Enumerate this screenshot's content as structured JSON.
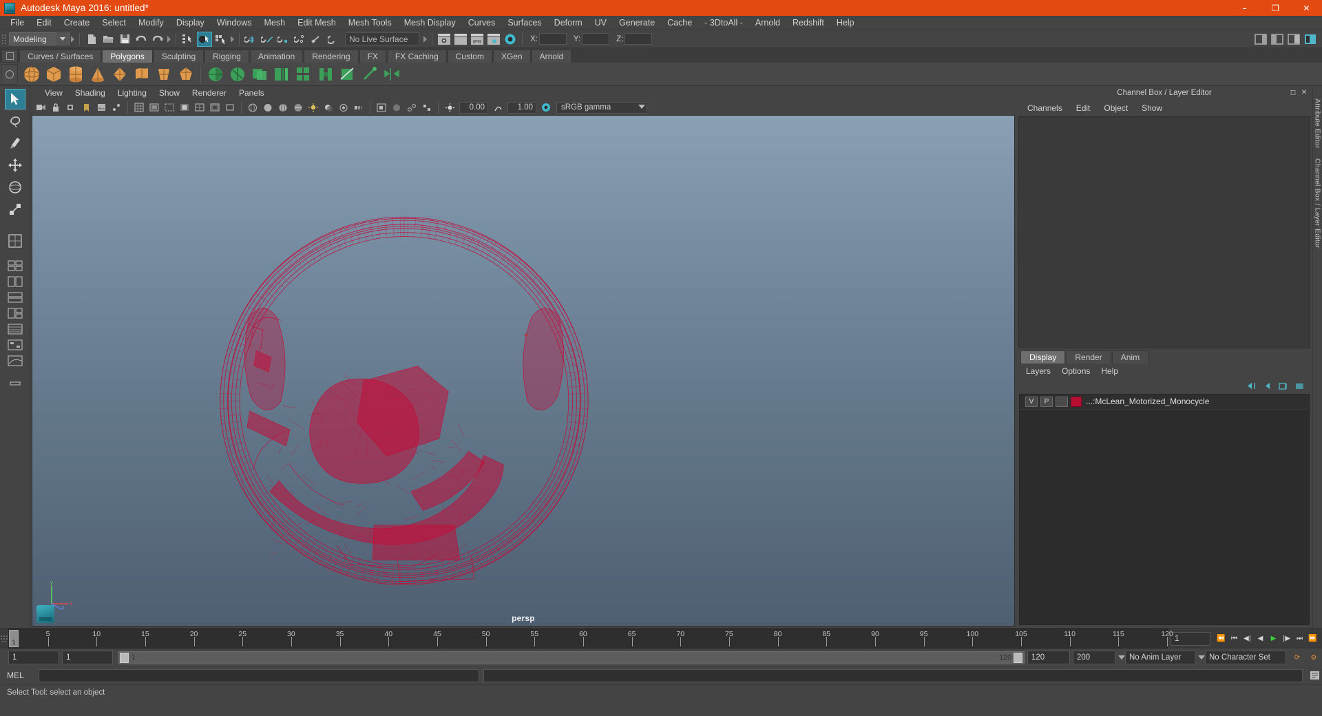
{
  "window": {
    "title": "Autodesk Maya 2016: untitled*",
    "app_icon": "maya-logo-icon",
    "minimize": "–",
    "maximize": "❐",
    "close": "✕",
    "accent_color": "#e34a12"
  },
  "menubar": {
    "items": [
      "File",
      "Edit",
      "Create",
      "Select",
      "Modify",
      "Display",
      "Windows",
      "Mesh",
      "Edit Mesh",
      "Mesh Tools",
      "Mesh Display",
      "Curves",
      "Surfaces",
      "Deform",
      "UV",
      "Generate",
      "Cache",
      "- 3DtoAll -",
      "Arnold",
      "Redshift",
      "Help"
    ]
  },
  "toolbar": {
    "mode": "Modeling",
    "live_surface": "No Live Surface",
    "coord_x_label": "X:",
    "coord_y_label": "Y:",
    "coord_z_label": "Z:",
    "coord_x_value": "",
    "coord_y_value": "",
    "coord_z_value": "",
    "icons": [
      "new-scene-icon",
      "open-scene-icon",
      "save-scene-icon",
      "undo-icon",
      "redo-icon",
      "select-by-hierarchy-icon",
      "select-by-object-icon",
      "select-by-component-icon",
      "snap-to-grid-icon",
      "snap-to-curve-icon",
      "snap-to-point-icon",
      "snap-to-projected-center-icon",
      "snap-to-view-plane-icon",
      "make-live-icon",
      "render-current-frame-icon",
      "render-sequence-icon",
      "ipr-render-icon",
      "render-settings-icon",
      "hypershade-icon",
      "editor-layout-icon"
    ]
  },
  "shelf": {
    "tabs": [
      "Curves / Surfaces",
      "Polygons",
      "Sculpting",
      "Rigging",
      "Animation",
      "Rendering",
      "FX",
      "FX Caching",
      "Custom",
      "XGen",
      "Arnold"
    ],
    "active_tab": "Polygons",
    "icons": [
      "poly-sphere-icon",
      "poly-cube-icon",
      "poly-cylinder-icon",
      "poly-cone-icon",
      "poly-torus-icon",
      "poly-plane-icon",
      "poly-disc-icon",
      "poly-platonic-icon",
      "poly-pyramid-icon",
      "poly-prism-icon",
      "poly-pipe-icon",
      "poly-helix-icon",
      "poly-gear-icon",
      "poly-soccer-ball-icon",
      "poly-super-ellipse-icon",
      "combine-icon",
      "separate-icon",
      "boolean-union-icon",
      "boolean-difference-icon",
      "boolean-intersection-icon",
      "smooth-icon",
      "extrude-icon",
      "bevel-icon",
      "bridge-icon",
      "append-polygon-icon",
      "multi-cut-icon",
      "target-weld-icon",
      "quad-draw-icon",
      "mirror-icon",
      "reduce-icon",
      "triangulate-icon",
      "quadrangulate-icon",
      "crease-icon"
    ]
  },
  "toolbox": {
    "tools": [
      {
        "name": "select-tool",
        "icon": "arrow-cursor-icon",
        "selected": true
      },
      {
        "name": "lasso-select-tool",
        "icon": "lasso-icon",
        "selected": false
      },
      {
        "name": "paint-select-tool",
        "icon": "paint-brush-icon",
        "selected": false
      },
      {
        "name": "move-tool",
        "icon": "move-arrows-icon",
        "selected": false
      },
      {
        "name": "rotate-tool",
        "icon": "rotate-circle-icon",
        "selected": false
      },
      {
        "name": "scale-tool",
        "icon": "scale-box-icon",
        "selected": false
      },
      {
        "name": "last-tool-used",
        "icon": "wrench-icon",
        "selected": false
      }
    ],
    "layout_presets": [
      "single-perspective-layout-icon",
      "four-view-layout-icon",
      "two-pane-side-layout-icon",
      "two-pane-stacked-layout-icon",
      "three-pane-layout-icon",
      "outliner-persp-layout-icon",
      "hypergraph-layout-icon",
      "persp-graph-layout-icon",
      "more-layouts-icon"
    ]
  },
  "viewport": {
    "menus": [
      "View",
      "Shading",
      "Lighting",
      "Show",
      "Renderer",
      "Panels"
    ],
    "camera_label": "persp",
    "exposure_value": "0.00",
    "gamma_value": "1.00",
    "color_management": "sRGB gamma",
    "model_color": "#c20e3a",
    "background_top": "#8aa0b4",
    "background_bottom": "#4f5f72",
    "axis_labels": {
      "x": "x",
      "y": "y",
      "z": "z"
    },
    "toolbar_icons": [
      "select-camera-icon",
      "lock-camera-icon",
      "camera-attributes-icon",
      "bookmarks-icon",
      "image-plane-icon",
      "twopoint-icon",
      "grid-toggle-icon",
      "film-gate-icon",
      "resolution-gate-icon",
      "gate-mask-icon",
      "field-chart-icon",
      "safe-action-icon",
      "safe-title-icon",
      "wireframe-icon",
      "smooth-shade-icon",
      "shaded-wireframe-icon",
      "textured-icon",
      "lighting-icon",
      "shadows-icon",
      "ao-icon",
      "motion-blur-icon",
      "isolate-select-icon",
      "xray-icon",
      "xray-joints-icon",
      "xray-active-components-icon",
      "exposure-icon",
      "gamma-icon",
      "color-management-icon"
    ]
  },
  "channel_box": {
    "panel_title": "Channel Box / Layer Editor",
    "tabs": [
      "Channels",
      "Edit",
      "Object",
      "Show"
    ],
    "rows": []
  },
  "layer_editor": {
    "tabs": [
      "Display",
      "Render",
      "Anim"
    ],
    "active_tab": "Display",
    "menus": [
      "Layers",
      "Options",
      "Help"
    ],
    "buttons": [
      "move-layer-up-icon",
      "move-layer-down-icon",
      "new-layer-icon",
      "new-layer-from-selected-icon"
    ],
    "layers": [
      {
        "visibility": "V",
        "playback": "P",
        "shading": "",
        "color": "#b80e32",
        "name": "...:McLean_Motorized_Monocycle"
      }
    ]
  },
  "right_strip": {
    "labels": [
      "Attribute Editor",
      "Channel Box / Layer Editor"
    ]
  },
  "timeline": {
    "current_frame": "1",
    "tick_labels": [
      "5",
      "10",
      "15",
      "20",
      "25",
      "30",
      "35",
      "40",
      "45",
      "50",
      "55",
      "60",
      "65",
      "70",
      "75",
      "80",
      "85",
      "90",
      "95",
      "100",
      "105",
      "110",
      "115",
      "120"
    ],
    "frame_field": "1",
    "playback_buttons": [
      "go-to-start-icon",
      "step-back-key-icon",
      "step-back-frame-icon",
      "play-backwards-icon",
      "play-forwards-icon",
      "step-forward-frame-icon",
      "step-forward-key-icon",
      "go-to-end-icon"
    ],
    "range_start": "1",
    "range_start_alt": "1",
    "range_bar_start": "1",
    "range_bar_end": "120",
    "range_end": "120",
    "playback_end": "200",
    "anim_layer": "No Anim Layer",
    "character_set": "No Character Set",
    "auto_key_icon": "auto-keyframe-icon",
    "anim_prefs_icon": "animation-preferences-icon"
  },
  "command_line": {
    "label": "MEL",
    "input_value": "",
    "output_value": "",
    "script_editor_icon": "script-editor-icon"
  },
  "status_bar": {
    "message": "Select Tool: select an object"
  }
}
